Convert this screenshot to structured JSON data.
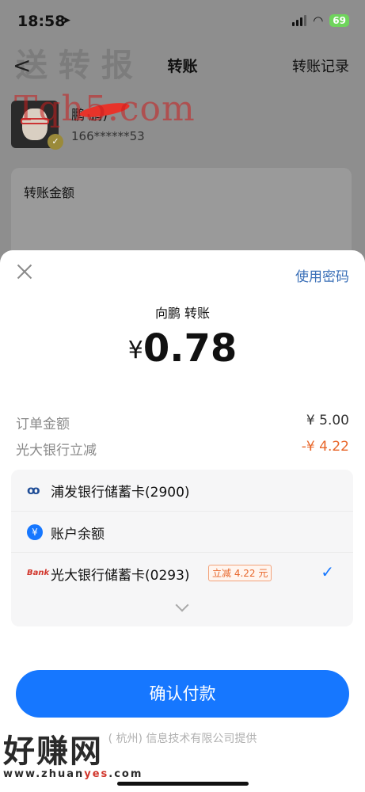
{
  "status_bar": {
    "time": "18:58",
    "battery": "69"
  },
  "nav": {
    "back": "<",
    "title": "转账",
    "right": "转账记录"
  },
  "recipient": {
    "name": "鹏   鹏)",
    "phone": "166******53"
  },
  "amount_card": {
    "label": "转账金额"
  },
  "sheet": {
    "use_password": "使用密码",
    "pay_to": "向鹏        转账",
    "currency": "¥",
    "amount": "0.78",
    "order_amount_label": "订单金额",
    "order_amount_value": "¥ 5.00",
    "discount_label": "光大银行立减",
    "discount_value": "-¥ 4.22",
    "methods": [
      {
        "label": "浦发银行储蓄卡(2900)",
        "icon": "spdb-bank-icon"
      },
      {
        "label": "账户余额",
        "icon": "yuan-balance-icon"
      },
      {
        "label": "光大银行储蓄卡(0293)",
        "icon": "ceb-bank-icon",
        "tag": "立减 4.22 元",
        "selected": true
      }
    ],
    "confirm": "确认付款",
    "footer": "( 杭州) 信息技术有限公司提供"
  },
  "watermarks": {
    "top": "Tqh5.com",
    "top_cn": "送 转 报",
    "bottom_big": "好赚网",
    "bottom_small_pre": "www.zhuan",
    "bottom_small_mid": "yes",
    "bottom_small_post": ".com"
  },
  "colors": {
    "accent": "#1677ff",
    "discount": "#e8662a",
    "link": "#3a6fb7"
  }
}
